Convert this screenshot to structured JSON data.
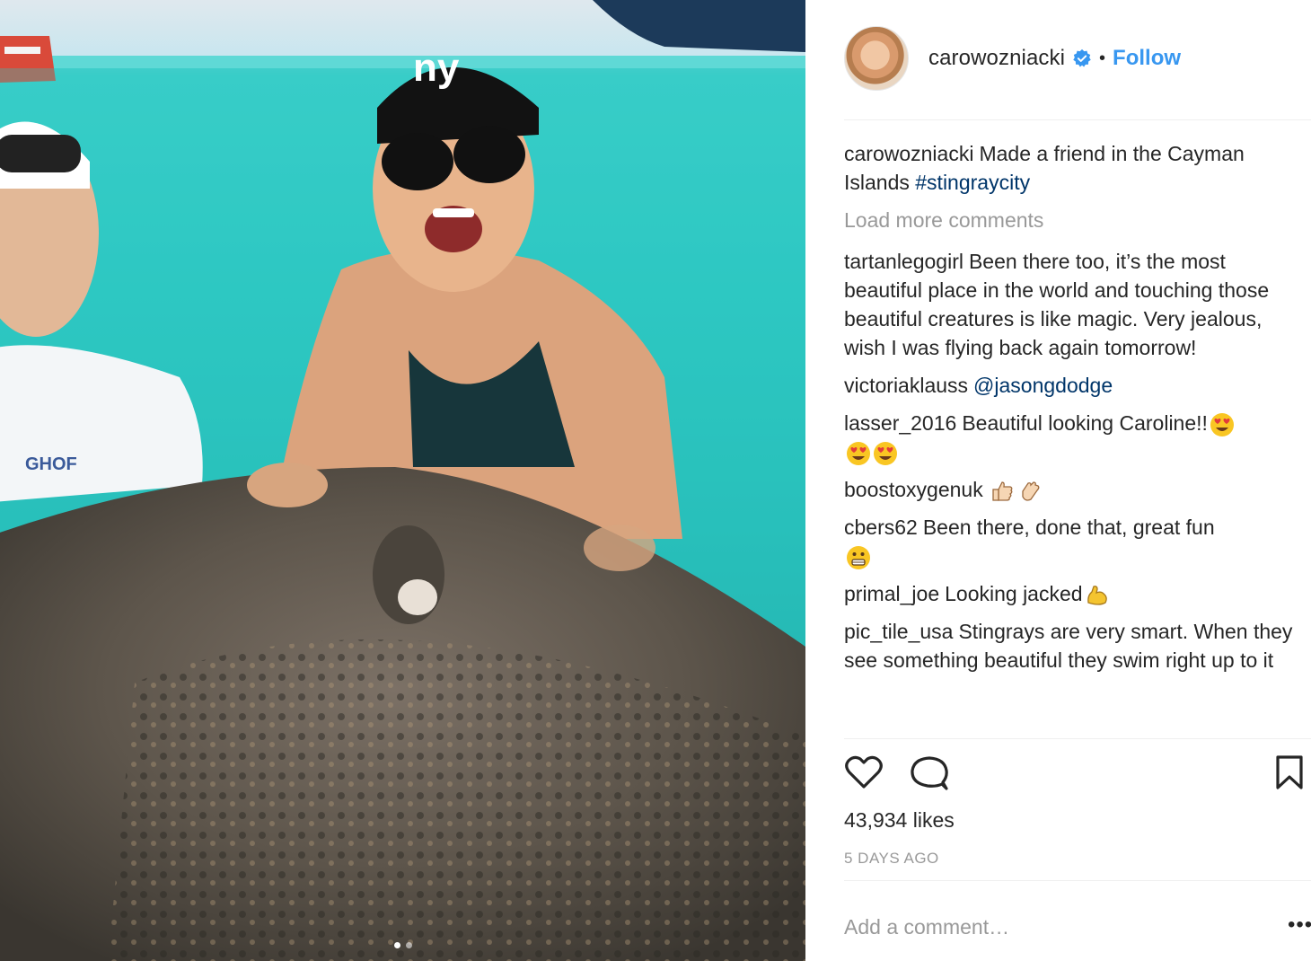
{
  "post": {
    "username": "carowozniacki",
    "verified": true,
    "separator": "•",
    "follow_label": "Follow",
    "caption": {
      "user": "carowozniacki",
      "text": "Made a friend in the Cayman Islands ",
      "hashtag": "#stingraycity"
    },
    "load_more_label": "Load more comments",
    "comments": [
      {
        "user": "tartanlegogirl",
        "text": "Been there too, it’s the most beautiful place in the world and touching those beautiful creatures is like magic. Very jealous, wish I was flying back again tomorrow!"
      },
      {
        "user": "victoriaklauss",
        "mention": "@jasongdodge"
      },
      {
        "user": "lasser_2016",
        "text": "Beautiful looking Caroline!!",
        "emojis": [
          "heart-eyes-emoji",
          "heart-eyes-emoji",
          "heart-eyes-emoji"
        ]
      },
      {
        "user": "boostoxygenuk",
        "text": "",
        "emojis": [
          "thumbs-up-emoji",
          "clap-emoji"
        ]
      },
      {
        "user": "cbers62",
        "text": "Been there, done that, great fun",
        "emojis": [
          "grimace-emoji"
        ]
      },
      {
        "user": "primal_joe",
        "text": "Looking jacked",
        "emojis": [
          "flexed-biceps-emoji"
        ]
      },
      {
        "user": "pic_tile_usa",
        "text": "Stingrays are very smart. When they see something beautiful they swim right up to it"
      }
    ],
    "likes": "43,934 likes",
    "timestamp": "5 DAYS AGO",
    "add_comment_placeholder": "Add a comment…",
    "more_label": "•••",
    "carousel": {
      "count": 2,
      "active": 0
    }
  },
  "icons": [
    "heart-icon",
    "comment-icon",
    "bookmark-icon",
    "verified-badge-icon"
  ],
  "colors": {
    "link": "#3897f0",
    "hashtag": "#003569",
    "muted": "#999999",
    "text": "#262626"
  }
}
